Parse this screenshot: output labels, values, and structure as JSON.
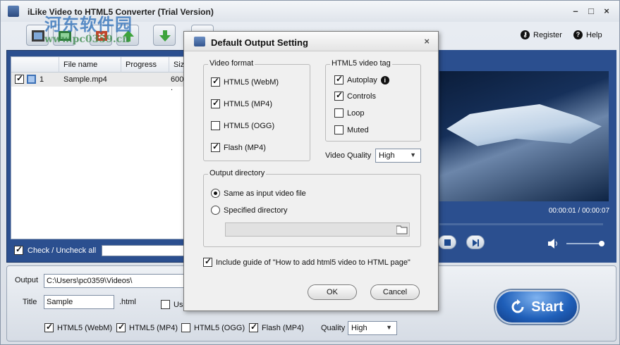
{
  "app": {
    "title": "iLike Video to HTML5 Converter (Trial Version)",
    "register_label": "Register",
    "help_label": "Help"
  },
  "watermark": {
    "line1": "河东软件园",
    "line2": "www.pc0359.cn"
  },
  "file_list": {
    "columns": [
      "File name",
      "Progress",
      "Size"
    ],
    "rows": [
      {
        "index": "1",
        "name": "Sample.mp4",
        "progress": "",
        "size": "600 ."
      }
    ],
    "check_all_label": "Check / Uncheck all"
  },
  "preview": {
    "timecode": "00:00:01 / 00:00:07"
  },
  "output": {
    "output_label": "Output",
    "output_path": "C:\\Users\\pc0359\\Videos\\",
    "title_label": "Title",
    "title_value": "Sample",
    "ext_label": ".html",
    "use_label": "Us",
    "formats": [
      {
        "label": "HTML5 (WebM)",
        "checked": true
      },
      {
        "label": "HTML5 (MP4)",
        "checked": true
      },
      {
        "label": "HTML5 (OGG)",
        "checked": false
      },
      {
        "label": "Flash (MP4)",
        "checked": true
      }
    ],
    "quality_label": "Quality",
    "quality_value": "High",
    "start_label": "Start"
  },
  "dialog": {
    "title": "Default Output Setting",
    "video_format": {
      "title": "Video format",
      "options": [
        {
          "label": "HTML5 (WebM)",
          "checked": true
        },
        {
          "label": "HTML5 (MP4)",
          "checked": true
        },
        {
          "label": "HTML5 (OGG)",
          "checked": false
        },
        {
          "label": "Flash (MP4)",
          "checked": true
        }
      ]
    },
    "video_tag": {
      "title": "HTML5 video tag",
      "options": [
        {
          "label": "Autoplay",
          "checked": true
        },
        {
          "label": "Controls",
          "checked": true
        },
        {
          "label": "Loop",
          "checked": false
        },
        {
          "label": "Muted",
          "checked": false
        }
      ]
    },
    "quality_label": "Video Quality",
    "quality_value": "High",
    "output_directory": {
      "title": "Output directory",
      "same_label": "Same as input video file",
      "specified_label": "Specified directory",
      "selected": "same",
      "path_value": ""
    },
    "include_guide_label": "Include guide of \"How to add html5 video to HTML page\"",
    "include_guide_checked": true,
    "ok_label": "OK",
    "cancel_label": "Cancel"
  }
}
